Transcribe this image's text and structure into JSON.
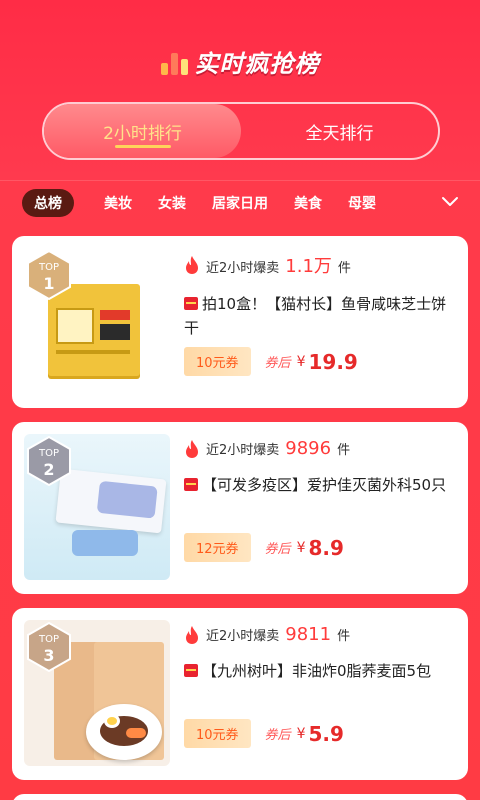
{
  "header": {
    "title": "实时疯抢榜",
    "tabs": [
      {
        "label": "2小时排行",
        "active": true
      },
      {
        "label": "全天排行",
        "active": false
      }
    ]
  },
  "categories": {
    "items": [
      "总榜",
      "美妆",
      "女装",
      "居家日用",
      "美食",
      "母婴"
    ],
    "active_index": 0,
    "more_icon": "chevron-down-icon"
  },
  "products": [
    {
      "rank_top": "TOP",
      "rank_num": "1",
      "sales_prefix": "近2小时爆卖",
      "sales_num": "1.1万",
      "sales_unit": "件",
      "name": "拍10盒！【猫村长】鱼骨咸味芝士饼干",
      "coupon": "10元券",
      "after_label": "券后",
      "currency": "¥",
      "price": "19.9"
    },
    {
      "rank_top": "TOP",
      "rank_num": "2",
      "sales_prefix": "近2小时爆卖",
      "sales_num": "9896",
      "sales_unit": "件",
      "name": "【可发多疫区】爱护佳灭菌外科50只",
      "coupon": "12元券",
      "after_label": "券后",
      "currency": "¥",
      "price": "8.9"
    },
    {
      "rank_top": "TOP",
      "rank_num": "3",
      "sales_prefix": "近2小时爆卖",
      "sales_num": "9811",
      "sales_unit": "件",
      "name": "【九州树叶】非油炸0脂荞麦面5包",
      "coupon": "10元券",
      "after_label": "券后",
      "currency": "¥",
      "price": "5.9"
    }
  ],
  "colors": {
    "background": "#ff3a4b",
    "price": "#e62a2a",
    "tab_active_text": "#ffe38a",
    "badge_gold": "#d9b07a",
    "badge_silver": "#9a9aa6",
    "badge_bronze": "#c7a588"
  }
}
